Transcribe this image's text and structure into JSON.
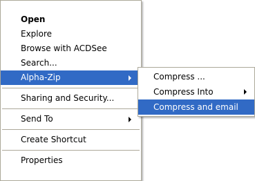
{
  "context_menu": {
    "items": [
      {
        "label": "Open"
      },
      {
        "label": "Explore"
      },
      {
        "label": "Browse with ACDSee"
      },
      {
        "label": "Search..."
      },
      {
        "label": "Alpha-Zip"
      },
      {
        "label": "Sharing and Security..."
      },
      {
        "label": "Send To"
      },
      {
        "label": "Create Shortcut"
      },
      {
        "label": "Properties"
      }
    ]
  },
  "submenu": {
    "items": [
      {
        "label": "Compress ..."
      },
      {
        "label": "Compress Into"
      },
      {
        "label": "Compress and email"
      }
    ]
  },
  "colors": {
    "highlight": "#316ac5",
    "highlight_text": "#ffffff",
    "border": "#aca899"
  }
}
